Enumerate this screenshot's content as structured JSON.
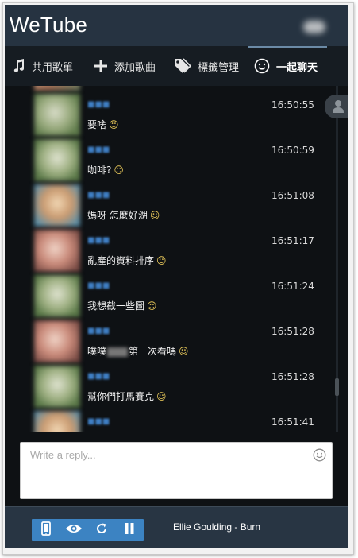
{
  "app": {
    "title": "WeTube"
  },
  "tabs": [
    {
      "label": "共用歌單",
      "icon": "music-note-icon"
    },
    {
      "label": "添加歌曲",
      "icon": "plus-icon"
    },
    {
      "label": "標籤管理",
      "icon": "tag-icon"
    },
    {
      "label": "一起聊天",
      "icon": "smiley-icon",
      "active": true
    }
  ],
  "messages": [
    {
      "time": "",
      "text": "",
      "partial_top": true
    },
    {
      "time": "16:50:55",
      "text": "要啥"
    },
    {
      "time": "16:50:59",
      "text": "咖啡?"
    },
    {
      "time": "16:51:08",
      "text": "媽呀 怎麼好湖"
    },
    {
      "time": "16:51:17",
      "text": "亂產的資料排序"
    },
    {
      "time": "16:51:24",
      "text": "我想截一些圖"
    },
    {
      "time": "16:51:28",
      "text_before": "噗噗",
      "text_after": "第一次看嗎"
    },
    {
      "time": "16:51:28",
      "text": "幫你們打馬賽克"
    },
    {
      "time": "16:51:41",
      "text": ""
    }
  ],
  "reply": {
    "placeholder": "Write a reply..."
  },
  "player": {
    "now_playing": "Ellie Goulding - Burn",
    "controls": [
      "phone-icon",
      "eye-icon",
      "refresh-icon",
      "pause-icon"
    ]
  },
  "colors": {
    "header_bg": "#263341",
    "tabs_bg": "#161c22",
    "chat_bg": "#0e1114",
    "accent": "#3c83c2",
    "smiley": "#e8c85a"
  }
}
